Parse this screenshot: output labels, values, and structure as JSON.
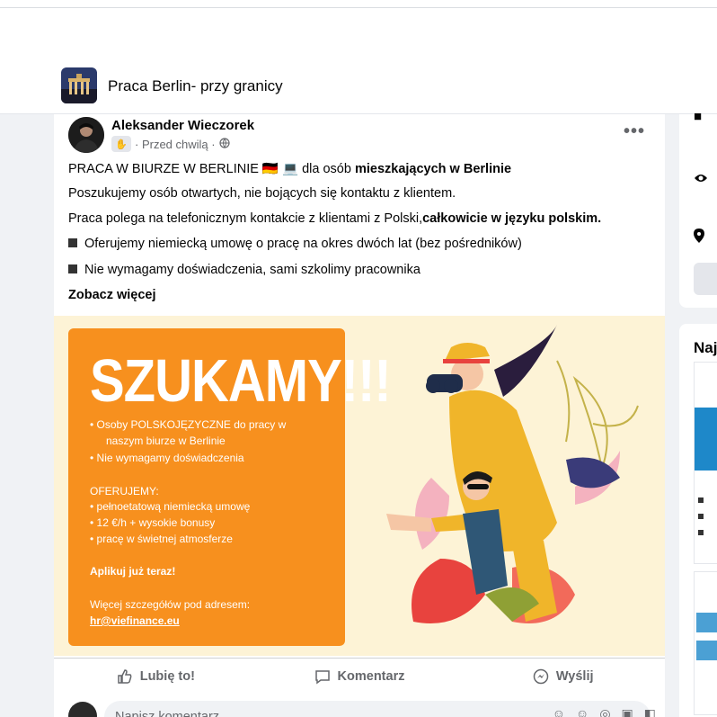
{
  "group": {
    "title": "Praca Berlin- przy granicy"
  },
  "post": {
    "author": "Aleksander Wieczorek",
    "time": "· Przed chwilą ·",
    "more_label": "•••",
    "line1_a": "PRACA W BIURZE W BERLINIE ",
    "line1_flag": "🇩🇪 💻",
    "line1_b": " dla osób ",
    "line1_bold": "mieszkających w Berlinie",
    "line2": "Poszukujemy osób otwartych, nie bojących się kontaktu z klientem.",
    "line3_a": "Praca polega na telefonicznym kontakcie z klientami z Polski,",
    "line3_bold": "całkowicie w języku polskim.",
    "bullet1": "Oferujemy niemiecką umowę o pracę na okres dwóch lat (bez pośredników)",
    "bullet2": "Nie wymagamy doświadczenia, sami szkolimy pracownika",
    "see_more": "Zobacz więcej"
  },
  "card": {
    "title": "SZUKAMY!!!",
    "b1a": "• Osoby POLSKOJĘZYCZNE do pracy w",
    "b1b": "naszym biurze w Berlinie",
    "b2": "• Nie wymagamy doświadczenia",
    "offer_title": "OFERUJEMY:",
    "o1": "• pełnoetatową niemiecką umowę",
    "o2": "• 12 €/h + wysokie bonusy",
    "o3": "• pracę w świetnej atmosferze",
    "apply": "Aplikuj już teraz!",
    "more_info": "Więcej szczegółów pod adresem:",
    "email": "hr@viefinance.eu"
  },
  "actions": {
    "like": "Lubię to!",
    "comment": "Komentarz",
    "share": "Wyślij"
  },
  "comment": {
    "placeholder": "Napisz komentarz..."
  },
  "sidebar": {
    "title": "Naj"
  }
}
